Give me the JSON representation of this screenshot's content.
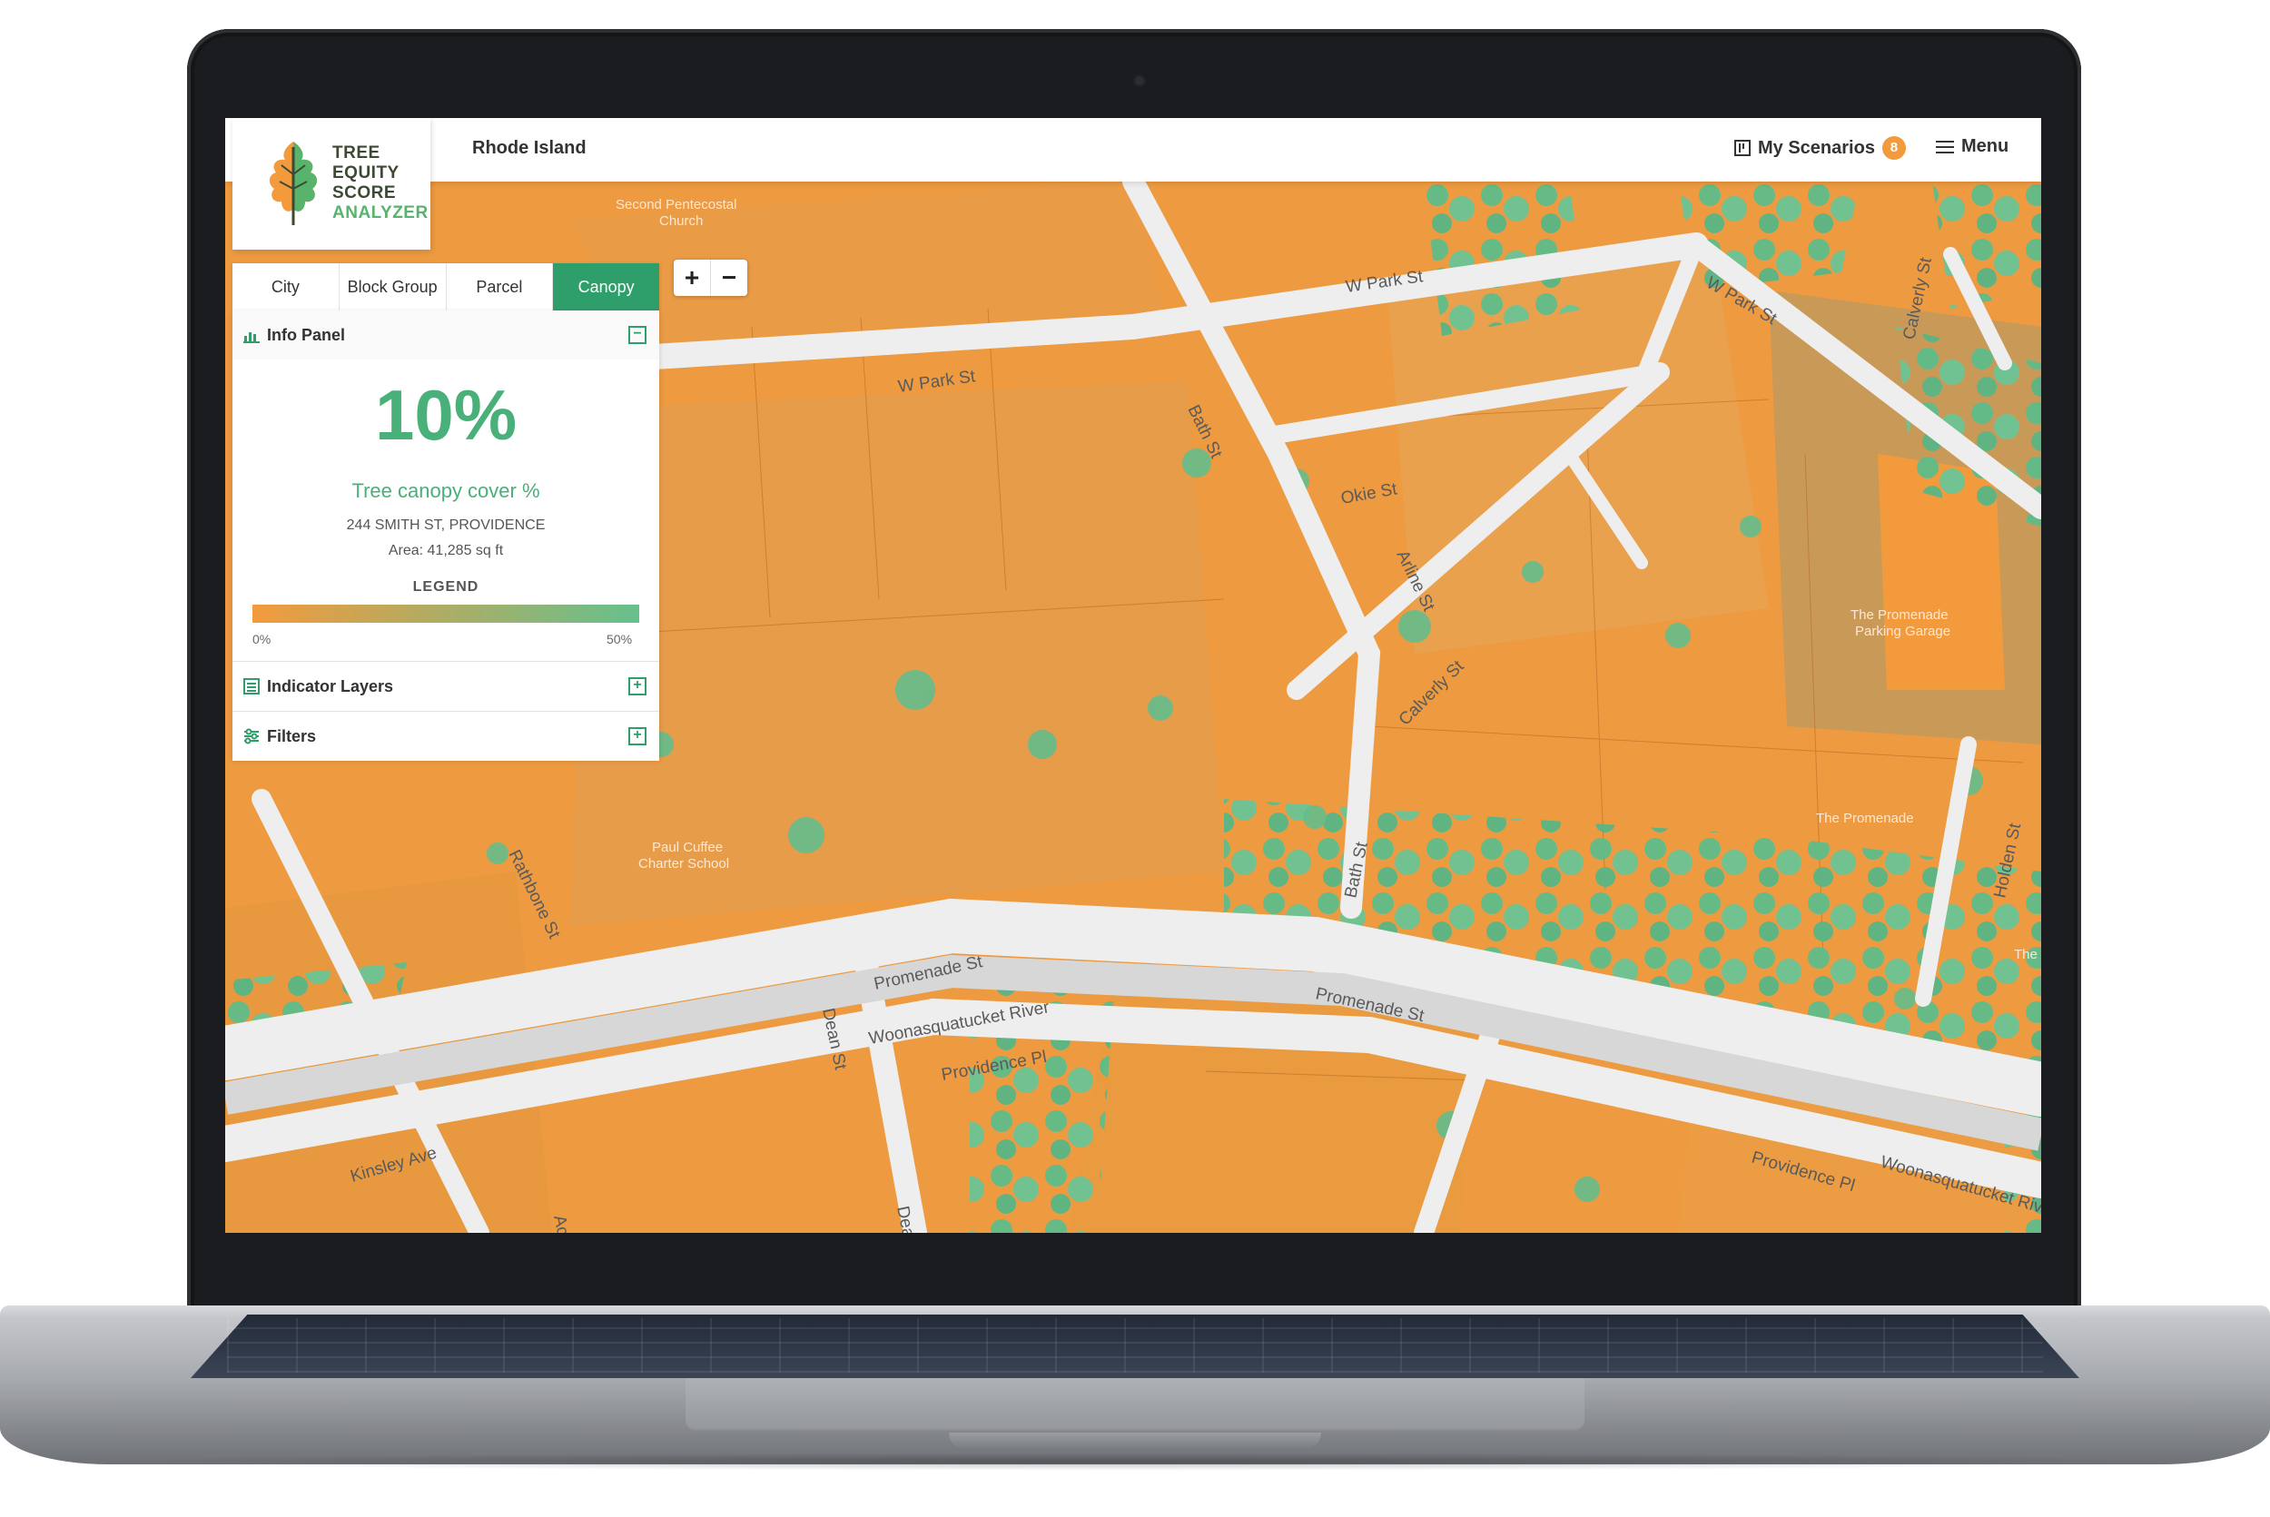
{
  "app": {
    "logo_lines": [
      "TREE",
      "EQUITY",
      "SCORE",
      "ANALYZER"
    ],
    "region": "Rhode Island"
  },
  "topbar": {
    "scenarios_label": "My Scenarios",
    "scenarios_count": "8",
    "menu_label": "Menu"
  },
  "tabs": [
    {
      "label": "City"
    },
    {
      "label": "Block Group"
    },
    {
      "label": "Parcel"
    },
    {
      "label": "Canopy",
      "active": true
    }
  ],
  "zoom": {
    "in": "+",
    "out": "−"
  },
  "info_panel": {
    "title": "Info Panel",
    "value": "10%",
    "metric": "Tree canopy cover %",
    "address": "244 SMITH ST, PROVIDENCE",
    "area": "Area: 41,285 sq ft",
    "legend_title": "LEGEND",
    "legend_min": "0%",
    "legend_max": "50%"
  },
  "sections": {
    "indicator_layers": "Indicator Layers",
    "filters": "Filters"
  },
  "map_labels": {
    "streets": [
      "W Park St",
      "W Park St",
      "W Park St",
      "Bath St",
      "Okie St",
      "Arline St",
      "Calverly St",
      "Bath St",
      "Promenade St",
      "Promenade St",
      "Woonasquatucket River",
      "Providence Pl",
      "Dean St",
      "Rathbone St",
      "Kinsley Ave",
      "Providence Pl",
      "Woonasquatucket Riv",
      "Holden St",
      "Acorn",
      "Dea",
      "Calverly St"
    ],
    "pois": [
      "Second Pentecostal Church",
      "Paul Cuffee Charter School",
      "The Promenade Parking Garage",
      "The Promenade",
      "The"
    ]
  },
  "colors": {
    "brand_green": "#2e9e6a",
    "canopy_green": "#49b07a",
    "parcel_orange": "#f39a3d",
    "badge_orange": "#f39a3d"
  }
}
